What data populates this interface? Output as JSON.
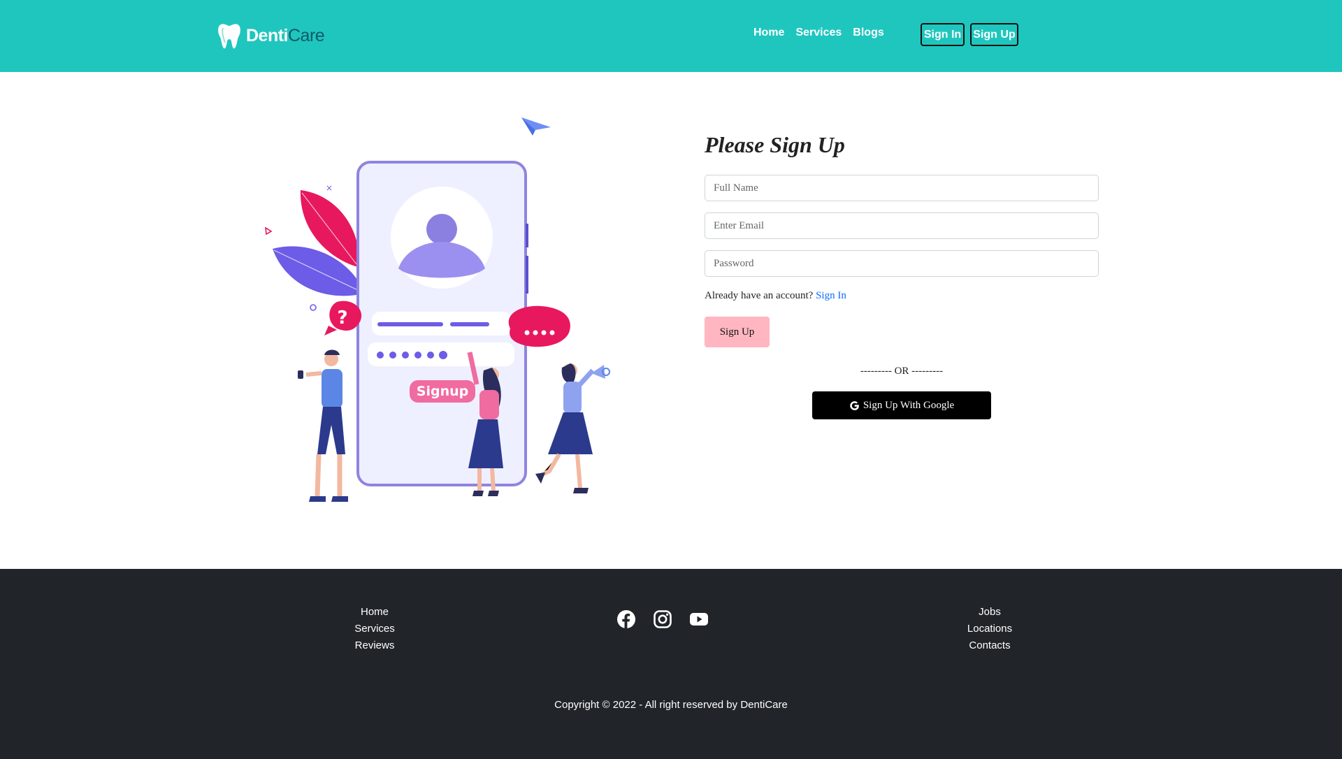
{
  "navbar": {
    "brand_part1": "Denti",
    "brand_part2": "Care",
    "links": [
      "Home",
      "Services",
      "Blogs"
    ],
    "sign_in": "Sign In",
    "sign_up": "Sign Up"
  },
  "illustration": {
    "signup_label": "Signup"
  },
  "form": {
    "title": "Please Sign Up",
    "name_placeholder": "Full Name",
    "email_placeholder": "Enter Email",
    "password_placeholder": "Password",
    "already_text": "Already have an account?",
    "sign_in_link": "Sign In",
    "submit_label": "Sign Up",
    "or_text": "--------- OR ---------",
    "google_label": "Sign Up With Google"
  },
  "footer": {
    "col1": [
      "Home",
      "Services",
      "Reviews"
    ],
    "col3": [
      "Jobs",
      "Locations",
      "Contacts"
    ],
    "social_icons": [
      "facebook-icon",
      "instagram-icon",
      "youtube-icon"
    ],
    "copyright": "Copyright © 2022 - All right reserved by DentiCare"
  },
  "colors": {
    "navbar": "#1fc6be",
    "footer": "#212529",
    "submit_bg": "#ffb6c1",
    "link": "#0d6efd",
    "accent_pink": "#e8185e",
    "accent_purple": "#6c5ce7"
  }
}
